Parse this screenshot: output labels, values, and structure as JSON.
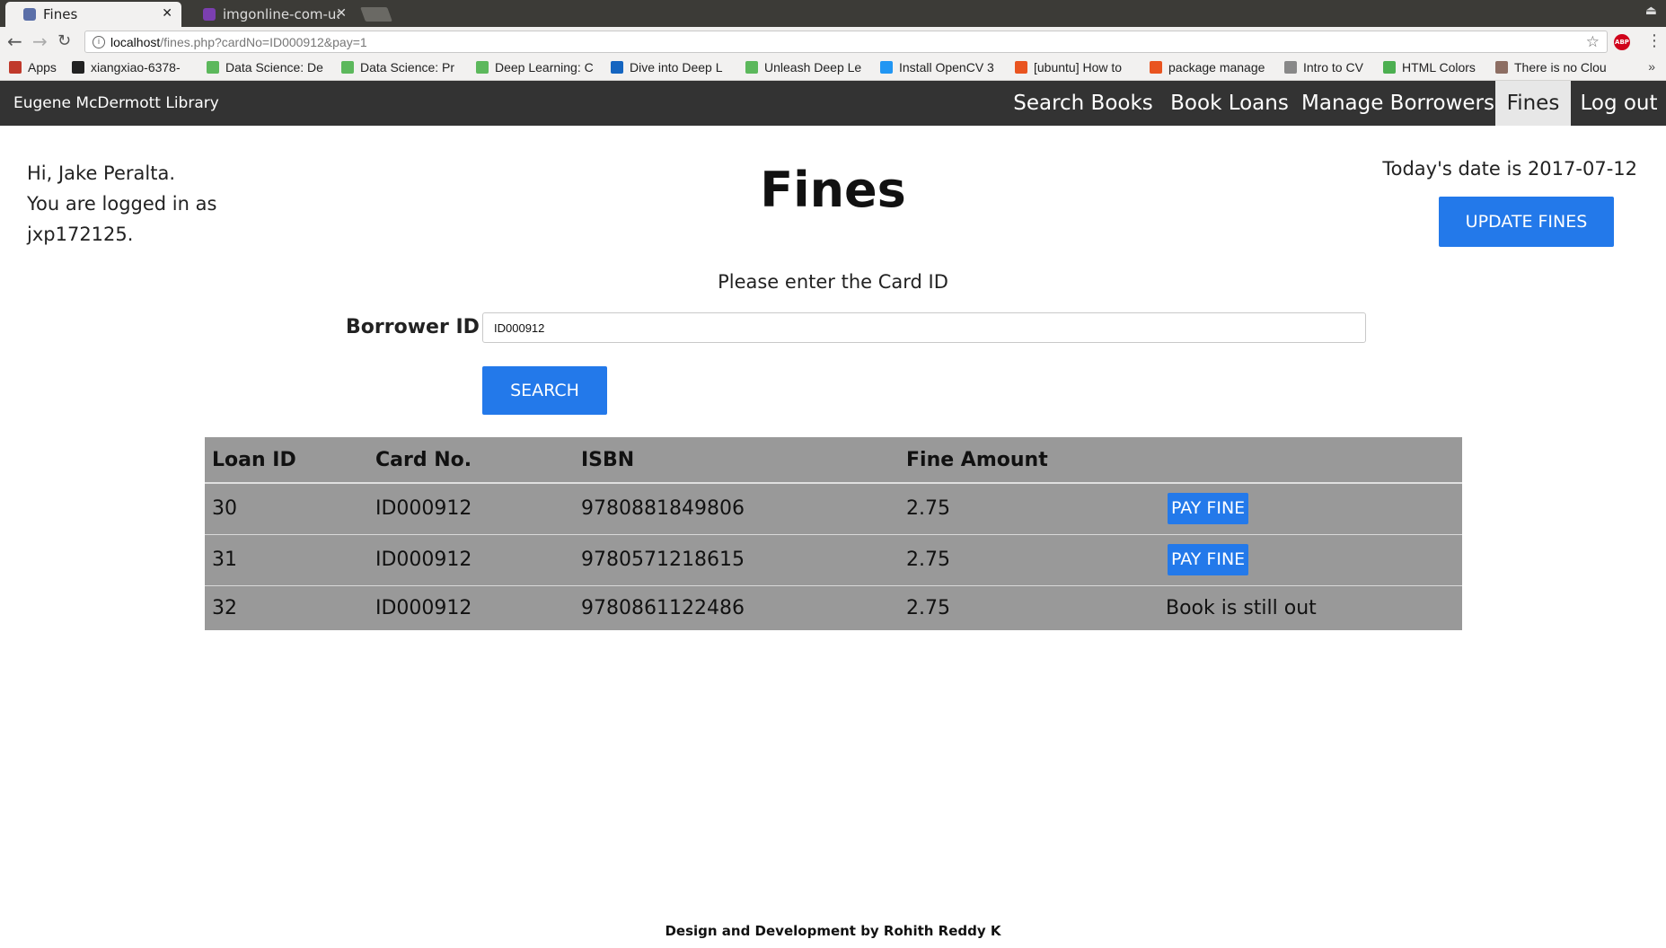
{
  "browser": {
    "tabs": [
      {
        "title": "Fines",
        "active": true
      },
      {
        "title": "imgonline-com-ua-l",
        "active": false
      }
    ],
    "url": {
      "host": "localhost",
      "path": "/fines.php?cardNo=ID000912&pay=1"
    },
    "bookmarks": [
      {
        "label": "Apps",
        "icon": "apps-grid-icon",
        "color": "#c0392b"
      },
      {
        "label": "xiangxiao-6378-",
        "icon": "github-icon",
        "color": "#222222"
      },
      {
        "label": "Data Science: De",
        "icon": "udemy-icon",
        "color": "#5cb85c"
      },
      {
        "label": "Data Science: Pr",
        "icon": "udemy-icon",
        "color": "#5cb85c"
      },
      {
        "label": "Deep Learning: C",
        "icon": "udemy-icon",
        "color": "#5cb85c"
      },
      {
        "label": "Dive into Deep L",
        "icon": "book-icon",
        "color": "#1565c0"
      },
      {
        "label": "Unleash Deep Le",
        "icon": "udemy-icon",
        "color": "#5cb85c"
      },
      {
        "label": "Install OpenCV 3",
        "icon": "p-circle-icon",
        "color": "#2196f3"
      },
      {
        "label": "[ubuntu] How to",
        "icon": "ubuntu-icon",
        "color": "#e95420"
      },
      {
        "label": "package manage",
        "icon": "askubuntu-icon",
        "color": "#e95420"
      },
      {
        "label": "Intro to CV",
        "icon": "folder-icon",
        "color": "#888888"
      },
      {
        "label": "HTML Colors",
        "icon": "colors-icon",
        "color": "#4caf50"
      },
      {
        "label": "There is no Clou",
        "icon": "cat-icon",
        "color": "#8d6e63"
      }
    ]
  },
  "navbar": {
    "brand": "Eugene McDermott Library",
    "links": [
      "Search Books",
      "Book Loans",
      "Manage Borrowers",
      "Fines",
      "Log out"
    ],
    "active": "Fines"
  },
  "greeting": {
    "line1": "Hi, Jake Peralta.",
    "line2": "You are logged in as",
    "line3": "jxp172125."
  },
  "page": {
    "title": "Fines",
    "today": "Today's date is 2017-07-12",
    "update_button": "UPDATE FINES",
    "prompt": "Please enter the Card ID",
    "borrower_label": "Borrower ID",
    "borrower_value": "ID000912",
    "search_button": "SEARCH"
  },
  "table": {
    "headers": [
      "Loan ID",
      "Card No.",
      "ISBN",
      "Fine Amount",
      ""
    ],
    "rows": [
      {
        "loan_id": "30",
        "card_no": "ID000912",
        "isbn": "9780881849806",
        "fine": "2.75",
        "action": "PAY FINE"
      },
      {
        "loan_id": "31",
        "card_no": "ID000912",
        "isbn": "9780571218615",
        "fine": "2.75",
        "action": "PAY FINE"
      },
      {
        "loan_id": "32",
        "card_no": "ID000912",
        "isbn": "9780861122486",
        "fine": "2.75",
        "status": "Book is still out"
      }
    ]
  },
  "footer": "Design and Development by Rohith Reddy K",
  "colors": {
    "accent": "#2379ea",
    "navbar": "#333333",
    "table_bg": "#999999"
  }
}
